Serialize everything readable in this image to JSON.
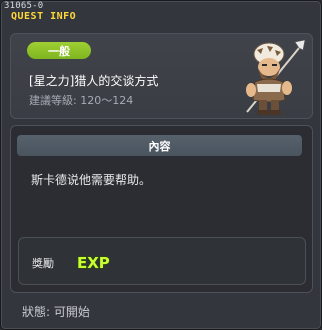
{
  "window": {
    "quest_id": "31065-0",
    "header_label": "QUEST INFO"
  },
  "quest": {
    "category_badge": "一般",
    "title": "[星之力]猎人的交谈方式",
    "level_text": "建議等級: 120～124",
    "npc_icon": "hunter-npc-icon"
  },
  "content": {
    "section_title": "內容",
    "text": "斯卡德说他需要帮助。"
  },
  "reward": {
    "label": "獎勵",
    "exp_text": "EXP",
    "exp_icon": "exp-icon"
  },
  "status": {
    "text": "狀態:  可開始"
  },
  "colors": {
    "header_yellow": "#ffd83a",
    "badge_green": "#8dc22a",
    "exp_green": "#c8ff33"
  }
}
